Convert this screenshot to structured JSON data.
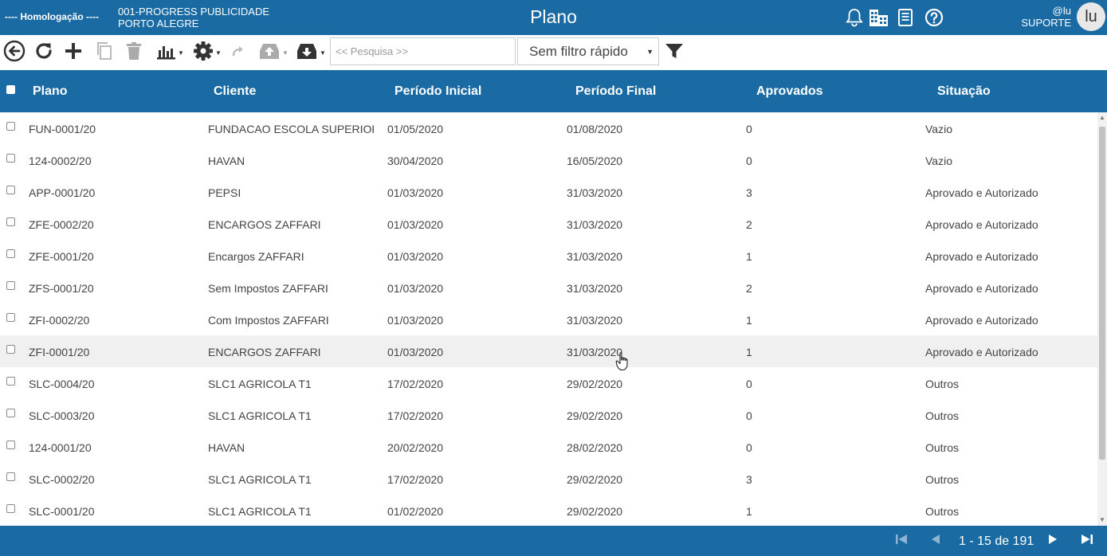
{
  "header": {
    "env_label": "---- Homologação ----",
    "company_line1": "001-PROGRESS PUBLICIDADE",
    "company_line2": "PORTO ALEGRE",
    "title": "Plano",
    "user_handle": "@lu",
    "user_role": "SUPORTE",
    "avatar_text": "lu",
    "icons": [
      "bell-icon",
      "buildings-icon",
      "document-icon",
      "help-icon"
    ]
  },
  "toolbar": {
    "search_placeholder": "<< Pesquisa >>",
    "quick_filter": "Sem filtro rápido",
    "icons": [
      "back-icon",
      "refresh-icon",
      "add-icon",
      "copy-icon",
      "delete-icon",
      "chart-icon",
      "settings-icon",
      "redo-icon",
      "upload-icon",
      "download-icon",
      "filter-icon"
    ]
  },
  "table": {
    "columns": [
      "Plano",
      "Cliente",
      "Período Inicial",
      "Período Final",
      "Aprovados",
      "Situação"
    ],
    "rows": [
      [
        "FUN-0001/20",
        "FUNDACAO ESCOLA SUPERIOR...",
        "01/05/2020",
        "01/08/2020",
        "0",
        "Vazio"
      ],
      [
        "124-0002/20",
        "HAVAN",
        "30/04/2020",
        "16/05/2020",
        "0",
        "Vazio"
      ],
      [
        "APP-0001/20",
        "PEPSI",
        "01/03/2020",
        "31/03/2020",
        "3",
        "Aprovado e Autorizado"
      ],
      [
        "ZFE-0002/20",
        "ENCARGOS ZAFFARI",
        "01/03/2020",
        "31/03/2020",
        "2",
        "Aprovado e Autorizado"
      ],
      [
        "ZFE-0001/20",
        "Encargos ZAFFARI",
        "01/03/2020",
        "31/03/2020",
        "1",
        "Aprovado e Autorizado"
      ],
      [
        "ZFS-0001/20",
        "Sem Impostos ZAFFARI",
        "01/03/2020",
        "31/03/2020",
        "2",
        "Aprovado e Autorizado"
      ],
      [
        "ZFI-0002/20",
        "Com Impostos ZAFFARI",
        "01/03/2020",
        "31/03/2020",
        "1",
        "Aprovado e Autorizado"
      ],
      [
        "ZFI-0001/20",
        "ENCARGOS ZAFFARI",
        "01/03/2020",
        "31/03/2020",
        "1",
        "Aprovado e Autorizado"
      ],
      [
        "SLC-0004/20",
        "SLC1 AGRICOLA T1",
        "17/02/2020",
        "29/02/2020",
        "0",
        "Outros"
      ],
      [
        "SLC-0003/20",
        "SLC1 AGRICOLA T1",
        "17/02/2020",
        "29/02/2020",
        "0",
        "Outros"
      ],
      [
        "124-0001/20",
        "HAVAN",
        "20/02/2020",
        "28/02/2020",
        "0",
        "Outros"
      ],
      [
        "SLC-0002/20",
        "SLC1 AGRICOLA T1",
        "17/02/2020",
        "29/02/2020",
        "3",
        "Outros"
      ],
      [
        "SLC-0001/20",
        "SLC1 AGRICOLA T1",
        "01/02/2020",
        "29/02/2020",
        "1",
        "Outros"
      ]
    ],
    "highlighted_row": 7
  },
  "footer": {
    "pagination": "1 - 15 de 191",
    "icons": [
      "first-page-icon",
      "prev-page-icon",
      "next-page-icon",
      "last-page-icon"
    ]
  },
  "colors": {
    "primary": "#1a6aa3",
    "row_highlight": "#f0f0f0"
  }
}
